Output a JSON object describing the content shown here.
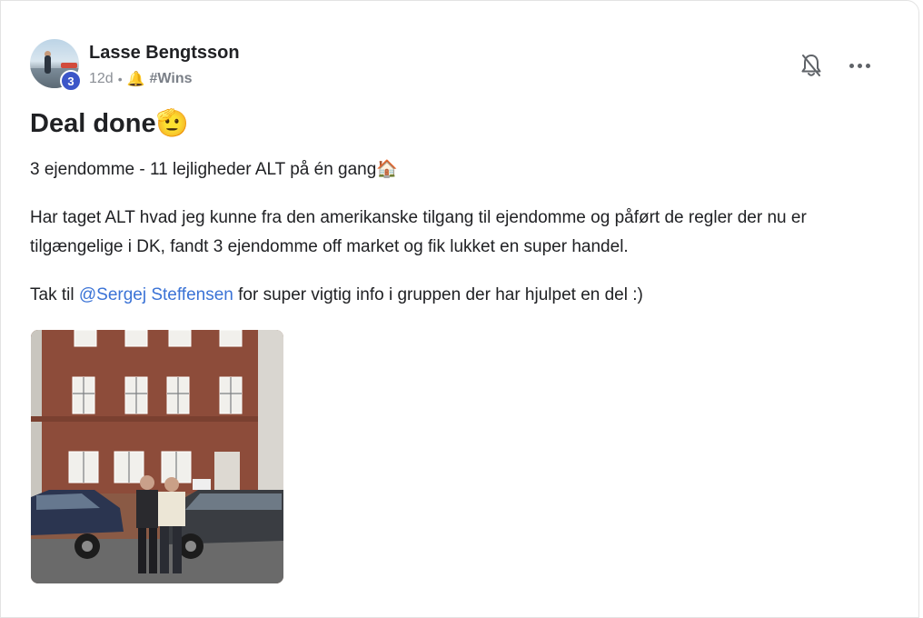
{
  "post": {
    "author": "Lasse Bengtsson",
    "level": "3",
    "time": "12d",
    "separator": "•",
    "category_icon": "bell-emoji",
    "category": "#Wins",
    "title": "Deal done🫡",
    "paragraphs": {
      "p1": "3 ejendomme - 11 lejligheder ALT på én gang🏠",
      "p2": "Har taget ALT hvad jeg kunne fra den amerikanske tilgang til ejendomme og påført de regler der nu er tilgængelige i DK, fandt 3 ejendomme off market og fik lukket en super handel.",
      "p3_prefix": "Tak til ",
      "p3_mention": "@Sergej Steffensen",
      "p3_suffix": " for super vigtig info i gruppen der har hjulpet en del :)"
    }
  },
  "actions": {
    "notify_icon": "bell-off-icon",
    "more_icon": "more-dots-icon"
  },
  "colors": {
    "accent": "#3b73d6",
    "level_badge": "#3c56c8",
    "meta_text": "#8b8f96"
  }
}
